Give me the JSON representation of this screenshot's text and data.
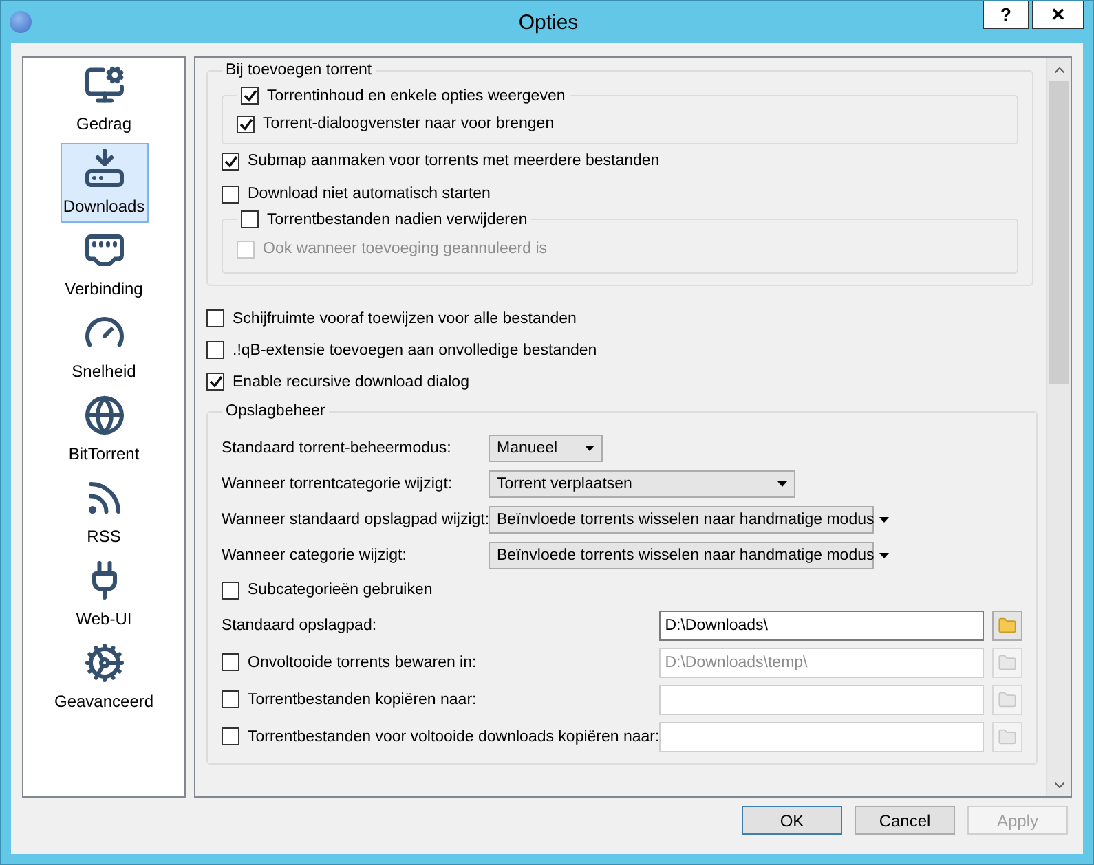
{
  "window": {
    "title": "Opties",
    "help_button": "?",
    "close_button": "✕"
  },
  "sidebar": {
    "items": [
      {
        "label": "Gedrag",
        "selected": false
      },
      {
        "label": "Downloads",
        "selected": true
      },
      {
        "label": "Verbinding",
        "selected": false
      },
      {
        "label": "Snelheid",
        "selected": false
      },
      {
        "label": "BitTorrent",
        "selected": false
      },
      {
        "label": "RSS",
        "selected": false
      },
      {
        "label": "Web-UI",
        "selected": false
      },
      {
        "label": "Geavanceerd",
        "selected": false
      }
    ]
  },
  "add_torrent": {
    "title": "Bij toevoegen torrent",
    "content_group": {
      "label": "Torrentinhoud en enkele opties weergeven",
      "checked": true,
      "options": [
        {
          "label": "Torrent-dialoogvenster naar voor brengen",
          "checked": true,
          "disabled": false
        }
      ]
    },
    "options": [
      {
        "label": "Submap aanmaken voor torrents met meerdere bestanden",
        "checked": true
      },
      {
        "label": "Download niet automatisch starten",
        "checked": false
      }
    ],
    "delete_group": {
      "label": "Torrentbestanden nadien verwijderen",
      "checked": false,
      "options": [
        {
          "label": "Ook wanneer toevoeging geannuleerd is",
          "checked": false,
          "disabled": true
        }
      ]
    }
  },
  "general_options": [
    {
      "label": "Schijfruimte vooraf toewijzen voor alle bestanden",
      "checked": false
    },
    {
      "label": ".!qB-extensie toevoegen aan onvolledige bestanden",
      "checked": false
    },
    {
      "label": "Enable recursive download dialog",
      "checked": true
    }
  ],
  "storage": {
    "title": "Opslagbeheer",
    "rows": [
      {
        "kind": "select",
        "label": "Standaard torrent-beheermodus:",
        "value": "Manueel"
      },
      {
        "kind": "select",
        "label": "Wanneer torrentcategorie wijzigt:",
        "value": "Torrent verplaatsen"
      },
      {
        "kind": "select",
        "label": "Wanneer standaard opslagpad wijzigt:",
        "value": "Beïnvloede torrents wisselen naar handmatige modus"
      },
      {
        "kind": "select",
        "label": "Wanneer categorie wijzigt:",
        "value": "Beïnvloede torrents wisselen naar handmatige modus"
      },
      {
        "kind": "checkbox",
        "label": "Subcategorieën gebruiken",
        "checked": false
      },
      {
        "kind": "path",
        "label": "Standaard opslagpad:",
        "value": "D:\\Downloads\\",
        "disabled": false
      },
      {
        "kind": "checked_path",
        "label": "Onvoltooide torrents bewaren in:",
        "checked": false,
        "value": "D:\\Downloads\\temp\\",
        "disabled": true
      },
      {
        "kind": "checked_path",
        "label": "Torrentbestanden kopiëren naar:",
        "checked": false,
        "disabled": true
      },
      {
        "kind": "checked_path",
        "label": "Torrentbestanden voor voltooide downloads kopiëren naar:",
        "checked": false,
        "disabled": true
      }
    ]
  },
  "buttons": [
    {
      "label": "OK",
      "default": true,
      "disabled": false
    },
    {
      "label": "Cancel",
      "default": false,
      "disabled": false
    },
    {
      "label": "Apply",
      "default": false,
      "disabled": true
    }
  ]
}
